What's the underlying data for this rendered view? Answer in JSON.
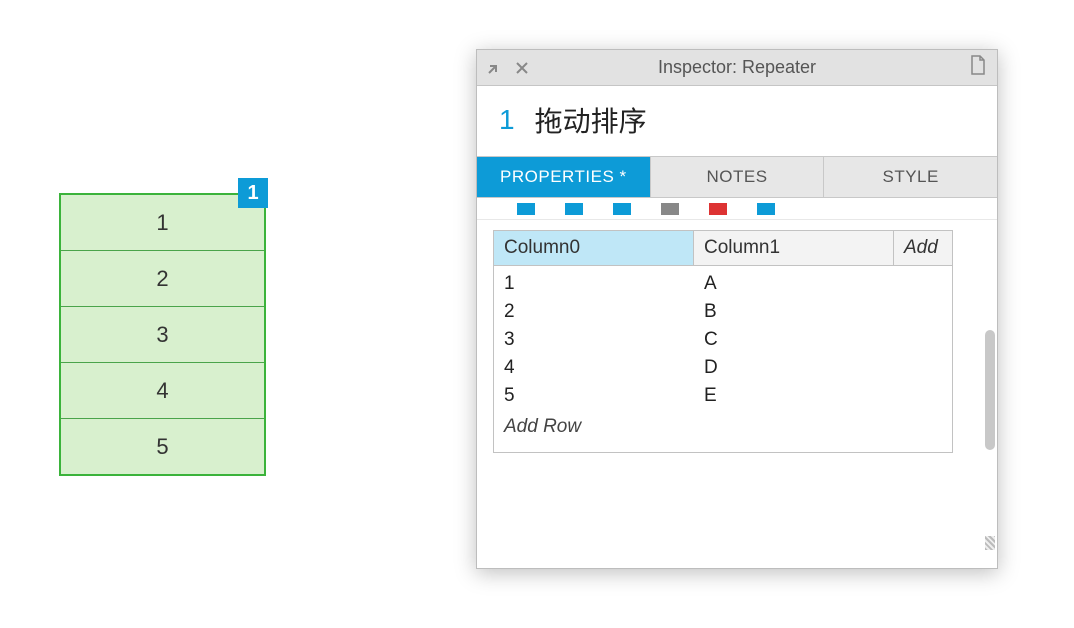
{
  "repeater": {
    "badge": "1",
    "rows": [
      "1",
      "2",
      "3",
      "4",
      "5"
    ]
  },
  "inspector": {
    "window_title": "Inspector: Repeater",
    "element_index": "1",
    "element_name": "拖动排序",
    "tabs": {
      "properties": "PROPERTIES *",
      "notes": "NOTES",
      "style": "STYLE"
    },
    "grid": {
      "columns": {
        "col0": "Column0",
        "col1": "Column1",
        "add": "Add"
      },
      "rows": [
        {
          "c0": "1",
          "c1": "A"
        },
        {
          "c0": "2",
          "c1": "B"
        },
        {
          "c0": "3",
          "c1": "C"
        },
        {
          "c0": "4",
          "c1": "D"
        },
        {
          "c0": "5",
          "c1": "E"
        }
      ],
      "add_row": "Add Row"
    }
  }
}
